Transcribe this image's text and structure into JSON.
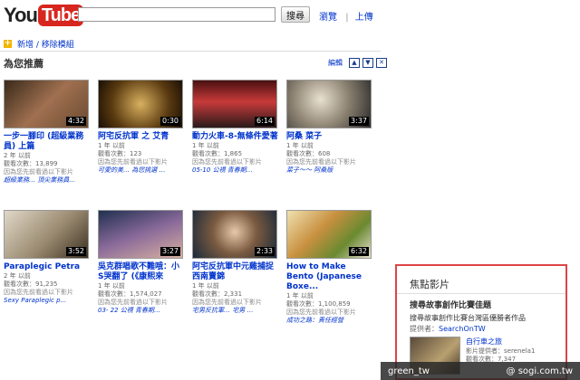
{
  "header": {
    "logo_you": "You",
    "logo_tube": "Tube",
    "search_placeholder": "",
    "search_button": "搜尋",
    "links": [
      "瀏覽",
      "上傳"
    ]
  },
  "module_bar": {
    "text": "新增 / 移除模組"
  },
  "section": {
    "title": "為您推薦",
    "edit": "編輯"
  },
  "videos": [
    {
      "title": "一步一腳印 (超級業務員) 上篇",
      "duration": "4:32",
      "meta1": "2 年 以前",
      "meta2": "觀看次數：13,899",
      "extra": "因為您先前看過以下影片",
      "link": "超級業務… 頂尖業務員…"
    },
    {
      "title": "阿宅反抗軍 之 艾青",
      "duration": "0:30",
      "meta1": "1 年 以前",
      "meta2": "觀看次數：123",
      "extra": "因為您先前看過以下影片",
      "link": "可愛的美… 為您挑選 …"
    },
    {
      "title": "動力火車-8-無條件愛著",
      "duration": "6:14",
      "meta1": "1 年 以前",
      "meta2": "觀看次數：1,865",
      "extra": "因為您先前看過以下影片",
      "link": "05-10 公視 青春期…"
    },
    {
      "title": "阿桑 菜子",
      "duration": "3:37",
      "meta1": "1 年 以前",
      "meta2": "觀看次數：608",
      "extra": "因為您先前看過以下影片",
      "link": "菜子～～ 阿桑版"
    },
    {
      "title": "Paraplegic Petra",
      "duration": "3:52",
      "meta1": "2 年 以前",
      "meta2": "觀看次數：91,235",
      "extra": "因為您先前看過以下影片",
      "link": "Sexy Paraplegic p..."
    },
    {
      "title": "吳克群唱歌不難哦：小S哭翻了 (《康熙來",
      "duration": "3:27",
      "meta1": "1 年 以前",
      "meta2": "觀看次數：1,574,027",
      "extra": "因為您先前看過以下影片",
      "link": "03- 22 公視 青春期…"
    },
    {
      "title": "阿宅反抗軍中元雞捕捉西南賣錦",
      "duration": "2:33",
      "meta1": "1 年 以前",
      "meta2": "觀看次數：2,331",
      "extra": "因為您先前看過以下影片",
      "link": "宅男反抗軍… 宅男 …"
    },
    {
      "title": "How to Make Bento (Japanese Boxe...",
      "duration": "6:32",
      "meta1": "1 年 以前",
      "meta2": "觀看次數：1,100,859",
      "extra": "因為您先前看過以下影片",
      "link": "成功之路：責任經營"
    }
  ],
  "spotlight": {
    "title": "焦點影片",
    "headline": "搜尋故事創作比賽佳題",
    "desc": "搜尋故事創作比賽台灣區優勝者作品",
    "author_label": "提供者：",
    "author": "SearchOnTW",
    "video_title": "自行車之旅",
    "video_meta1": "影片提供者：serenela1",
    "video_meta2": "觀看次數：7,347"
  },
  "watermark": {
    "left": "green_tw",
    "right": "@ sogi.com.tw"
  }
}
